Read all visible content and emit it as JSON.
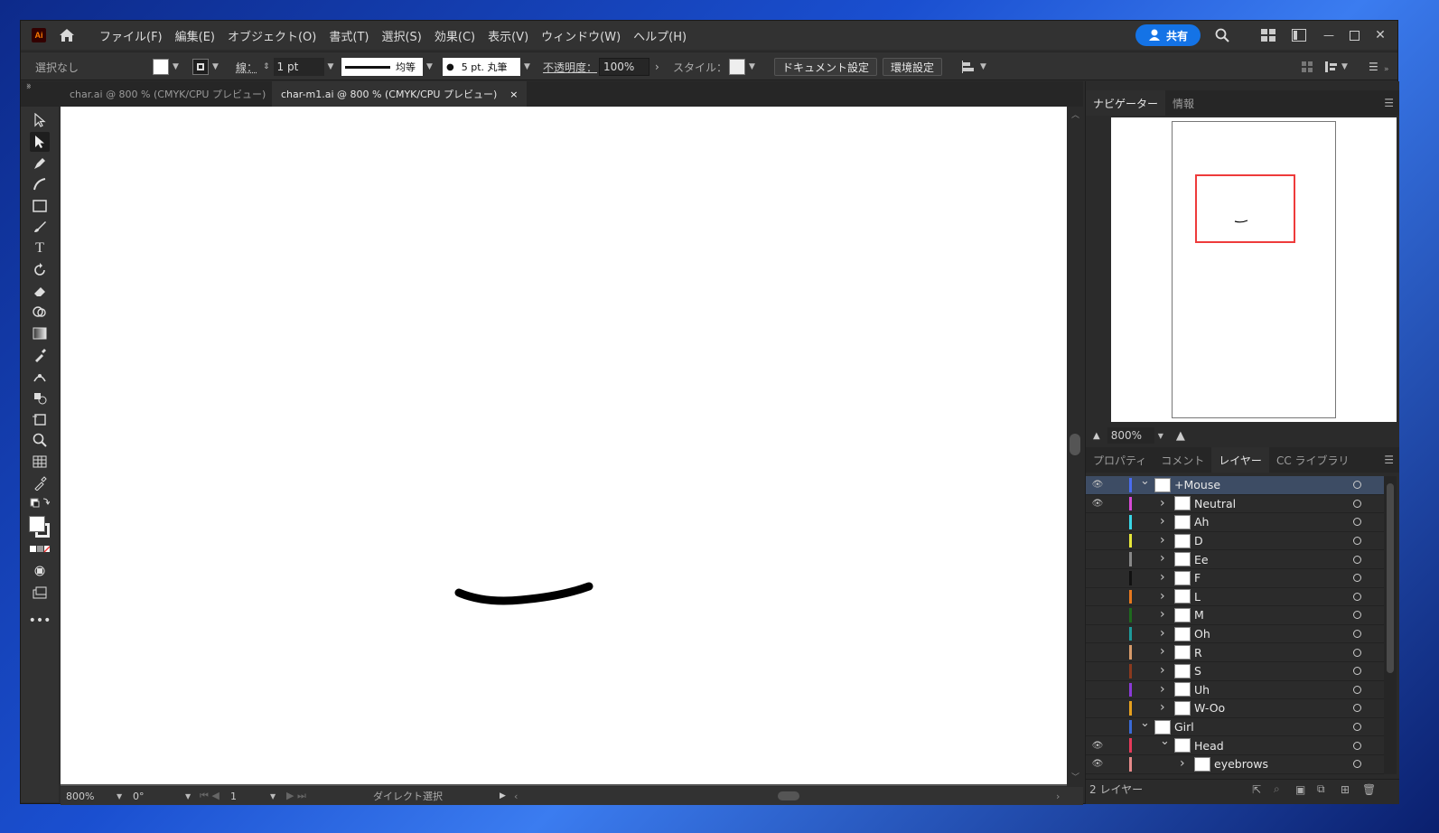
{
  "app": {
    "logo": "Ai",
    "share_label": "共有"
  },
  "menu": [
    "ファイル(F)",
    "編集(E)",
    "オブジェクト(O)",
    "書式(T)",
    "選択(S)",
    "効果(C)",
    "表示(V)",
    "ウィンドウ(W)",
    "ヘルプ(H)"
  ],
  "control": {
    "selection": "選択なし",
    "stroke_label": "線：",
    "stroke_weight": "1 pt",
    "stroke_profile": "均等",
    "brush": "5 pt. 丸筆",
    "opacity_label": "不透明度：",
    "opacity": "100%",
    "style_label": "スタイル：",
    "doc_settings": "ドキュメント設定",
    "prefs": "環境設定"
  },
  "tabs": [
    {
      "label": "char.ai @ 800 % (CMYK/CPU プレビュー)",
      "close": "×"
    },
    {
      "label": "char-m1.ai @ 800 % (CMYK/CPU プレビュー)",
      "close": "×"
    }
  ],
  "status": {
    "zoom": "800%",
    "rotation": "0°",
    "artboard": "1",
    "tool": "ダイレクト選択"
  },
  "navigator": {
    "tabs": [
      "ナビゲーター",
      "情報"
    ],
    "zoom": "800%"
  },
  "panel_tabs": [
    "プロパティ",
    "コメント",
    "レイヤー",
    "CC ライブラリ"
  ],
  "layers": [
    {
      "name": "+Mouse",
      "level": 0,
      "expanded": true,
      "visible": true,
      "color": "#4a6cf0",
      "selected": true
    },
    {
      "name": "Neutral",
      "level": 1,
      "expanded": false,
      "visible": true,
      "color": "#d64ad6"
    },
    {
      "name": "Ah",
      "level": 1,
      "expanded": false,
      "visible": false,
      "color": "#3ad6e6"
    },
    {
      "name": "D",
      "level": 1,
      "expanded": false,
      "visible": false,
      "color": "#e6e63a"
    },
    {
      "name": "Ee",
      "level": 1,
      "expanded": false,
      "visible": false,
      "color": "#888888"
    },
    {
      "name": "F",
      "level": 1,
      "expanded": false,
      "visible": false,
      "color": "#111111"
    },
    {
      "name": "L",
      "level": 1,
      "expanded": false,
      "visible": false,
      "color": "#e6781e"
    },
    {
      "name": "M",
      "level": 1,
      "expanded": false,
      "visible": false,
      "color": "#1e6a1e"
    },
    {
      "name": "Oh",
      "level": 1,
      "expanded": false,
      "visible": false,
      "color": "#1e9a9a"
    },
    {
      "name": "R",
      "level": 1,
      "expanded": false,
      "visible": false,
      "color": "#d69a6a"
    },
    {
      "name": "S",
      "level": 1,
      "expanded": false,
      "visible": false,
      "color": "#8a3a1e"
    },
    {
      "name": "Uh",
      "level": 1,
      "expanded": false,
      "visible": false,
      "color": "#8a3ad6"
    },
    {
      "name": "W-Oo",
      "level": 1,
      "expanded": false,
      "visible": false,
      "color": "#e6a01e"
    },
    {
      "name": "Girl",
      "level": 0,
      "expanded": true,
      "visible": false,
      "color": "#3a6ad6"
    },
    {
      "name": "Head",
      "level": 1,
      "expanded": true,
      "visible": true,
      "color": "#e63a5a"
    },
    {
      "name": "eyebrows",
      "level": 2,
      "expanded": false,
      "visible": true,
      "color": "#e68a8a"
    }
  ],
  "layers_footer": "2 レイヤー"
}
